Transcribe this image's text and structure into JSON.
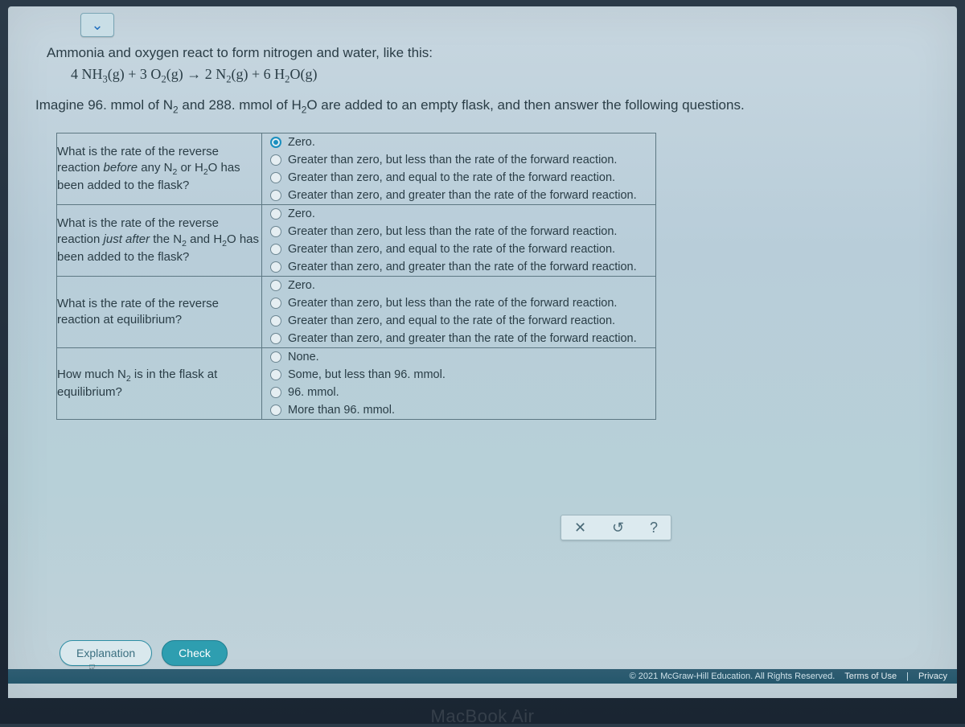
{
  "problem": {
    "intro": "Ammonia and oxygen react to form nitrogen and water, like this:",
    "equation_html": "4 NH<sub>3</sub>(g) + 3 O<sub>2</sub>(g) → 2 N<sub>2</sub>(g) + 6 H<sub>2</sub>O(g)",
    "setup_html": "Imagine 96. mmol of N<sub>2</sub> and 288. mmol of H<sub>2</sub>O are added to an empty flask, and then answer the following questions."
  },
  "questions": [
    {
      "prompt_html": "What is the rate of the reverse reaction <em class='ital'>before</em> any N<sub>2</sub> or H<sub>2</sub>O has been added to the flask?",
      "options": [
        "Zero.",
        "Greater than zero, but less than the rate of the forward reaction.",
        "Greater than zero, and equal to the rate of the forward reaction.",
        "Greater than zero, and greater than the rate of the forward reaction."
      ],
      "selected": 0
    },
    {
      "prompt_html": "What is the rate of the reverse reaction <em class='ital'>just after</em> the N<sub>2</sub> and H<sub>2</sub>O has been added to the flask?",
      "options": [
        "Zero.",
        "Greater than zero, but less than the rate of the forward reaction.",
        "Greater than zero, and equal to the rate of the forward reaction.",
        "Greater than zero, and greater than the rate of the forward reaction."
      ],
      "selected": null
    },
    {
      "prompt_html": "What is the rate of the reverse reaction at equilibrium?",
      "options": [
        "Zero.",
        "Greater than zero, but less than the rate of the forward reaction.",
        "Greater than zero, and equal to the rate of the forward reaction.",
        "Greater than zero, and greater than the rate of the forward reaction."
      ],
      "selected": null
    },
    {
      "prompt_html": "How much N<sub>2</sub> is in the flask at equilibrium?",
      "options": [
        "None.",
        "Some, but less than 96. mmol.",
        "96. mmol.",
        "More than 96. mmol."
      ],
      "selected": null
    }
  ],
  "util": {
    "close": "✕",
    "reset": "↺",
    "help": "?"
  },
  "actions": {
    "explanation": "Explanation",
    "check": "Check"
  },
  "footer": {
    "copyright": "© 2021 McGraw-Hill Education. All Rights Reserved.",
    "terms": "Terms of Use",
    "privacy": "Privacy"
  },
  "device": "MacBook Air"
}
